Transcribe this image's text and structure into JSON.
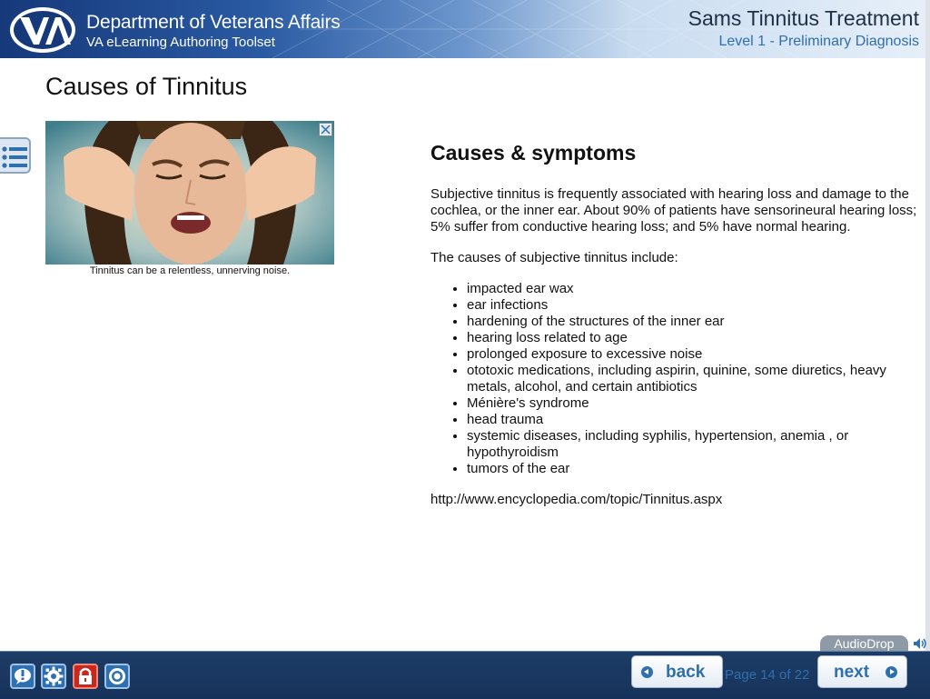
{
  "header": {
    "org_name": "Department of Veterans Affairs",
    "toolset_name": "VA eLearning Authoring Toolset",
    "course_title": "Sams Tinnitus Treatment",
    "course_level": "Level 1 - Preliminary Diagnosis",
    "logo_icon": "va-logo-icon"
  },
  "page": {
    "title": "Causes of Tinnitus"
  },
  "menu": {
    "icon": "list-menu-icon"
  },
  "figure": {
    "caption": "Tinnitus can be a relentless, unnerving noise.",
    "zoom_icon": "zoom-icon"
  },
  "content": {
    "heading": "Causes & symptoms",
    "intro": "Subjective tinnitus is frequently associated with hearing loss and damage to the cochlea, or the inner ear. About 90% of patients have sensorineural hearing loss; 5% suffer from conductive hearing loss; and 5% have normal hearing.",
    "list_intro": "The causes of subjective tinnitus include:",
    "causes": [
      "impacted ear wax",
      "ear infections",
      "hardening of the structures of the inner ear",
      "hearing loss related to age",
      "prolonged exposure to excessive noise",
      "ototoxic medications, including aspirin, quinine, some diuretics, heavy metals, alcohol, and certain antibiotics",
      "Ménière's syndrome",
      "head trauma",
      "systemic diseases, including syphilis, hypertension, anemia , or hypothyroidism",
      "tumors of the ear"
    ],
    "source": "http://www.encyclopedia.com/topic/Tinnitus.aspx"
  },
  "audio": {
    "label": "AudioDrop",
    "icon": "speaker-icon"
  },
  "footer": {
    "tools": [
      "help-icon",
      "settings-icon",
      "lock-icon",
      "target-icon"
    ],
    "back_label": "back",
    "next_label": "next",
    "page_counter": "Page 14 of 22"
  },
  "colors": {
    "header_dark": "#16397a",
    "footer_bg": "#1d3d66",
    "accent_blue": "#2f6fae",
    "lock_red": "#c8281d"
  }
}
